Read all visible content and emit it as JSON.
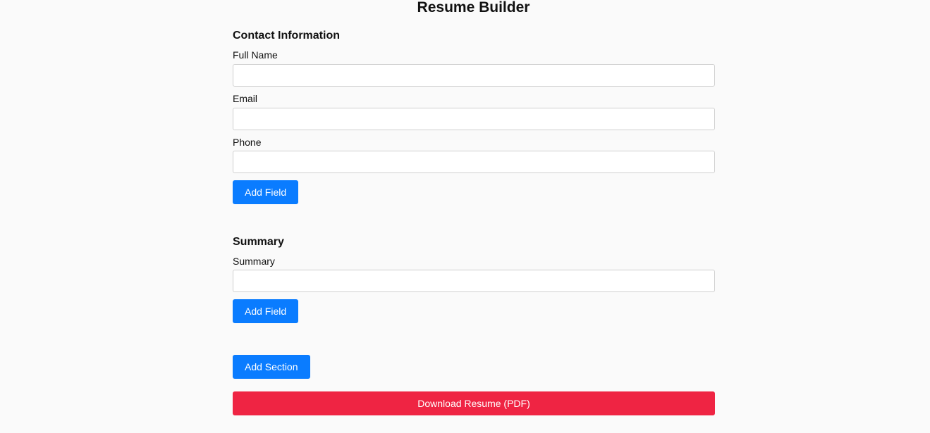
{
  "page": {
    "title": "Resume Builder"
  },
  "sections": [
    {
      "title": "Contact Information",
      "fields": [
        {
          "label": "Full Name",
          "value": "",
          "placeholder": ""
        },
        {
          "label": "Email",
          "value": "",
          "placeholder": ""
        },
        {
          "label": "Phone",
          "value": "",
          "placeholder": ""
        }
      ],
      "add_field_label": "Add Field"
    },
    {
      "title": "Summary",
      "fields": [
        {
          "label": "Summary",
          "value": "",
          "placeholder": ""
        }
      ],
      "add_field_label": "Add Field"
    }
  ],
  "actions": {
    "add_section_label": "Add Section",
    "download_label": "Download Resume (PDF)"
  },
  "colors": {
    "primary_button": "#0a7cff",
    "download_button": "#ef2443",
    "background": "#fafafa"
  }
}
